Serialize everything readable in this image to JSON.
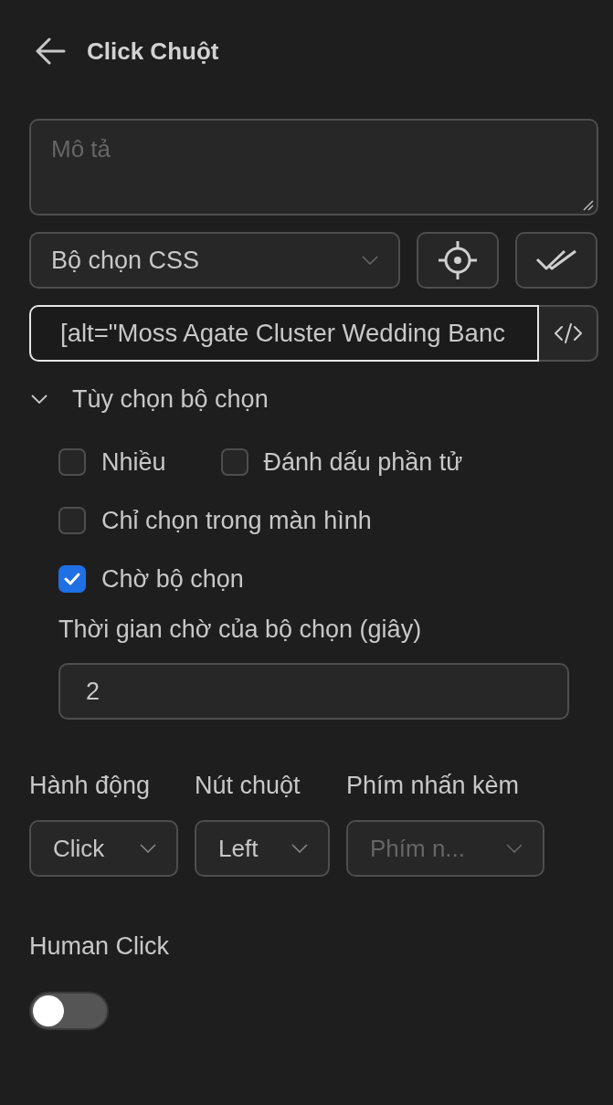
{
  "header": {
    "title": "Click Chuột"
  },
  "description": {
    "placeholder": "Mô tả"
  },
  "selector_type": {
    "value": "Bộ chọn CSS"
  },
  "selector": {
    "value": "[alt=\"Moss Agate Cluster Wedding Banc",
    "focused": true
  },
  "selector_options": {
    "label": "Tùy chọn bộ chọn",
    "expanded": true,
    "checkbox_rows": [
      {
        "items": [
          {
            "label": "Nhiều",
            "checked": false
          },
          {
            "label": "Đánh dấu phần tử",
            "checked": false
          }
        ]
      },
      {
        "items": [
          {
            "label": "Chỉ chọn trong màn hình",
            "checked": false
          }
        ]
      },
      {
        "items": [
          {
            "label": "Chờ bộ chọn",
            "checked": true
          }
        ]
      }
    ],
    "timeout": {
      "label": "Thời gian chờ của bộ chọn (giây)",
      "value": "2"
    }
  },
  "selects": [
    {
      "label": "Hành động",
      "value": "Click"
    },
    {
      "label": "Nút chuột",
      "value": "Left"
    },
    {
      "label": "Phím nhấn kèm",
      "placeholder": "Phím n..."
    }
  ],
  "human_click": {
    "label": "Human Click",
    "on": false
  }
}
